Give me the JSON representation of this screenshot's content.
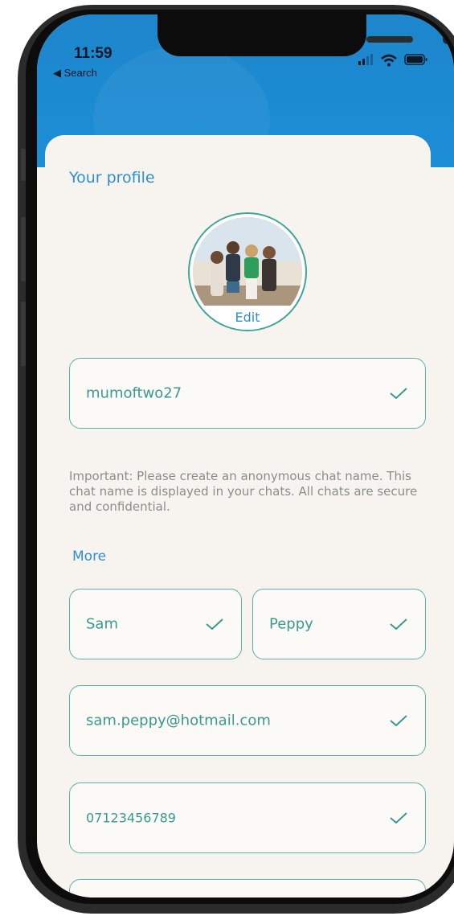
{
  "status_bar": {
    "time": "11:59",
    "back_label": "◀ Search"
  },
  "header": {
    "background": "#1d86cc"
  },
  "profile": {
    "title": "Your profile",
    "avatar_edit_label": "Edit",
    "chat_name": {
      "value": "mumoftwo27",
      "valid": true
    },
    "note": "Important: Please create an anonymous chat name. This chat name is displayed in your chats. All chats are secure and confidential.",
    "more_label": "More",
    "first_name": {
      "value": "Sam",
      "valid": true
    },
    "last_name": {
      "value": "Peppy",
      "valid": true
    },
    "email": {
      "value": "sam.peppy@hotmail.com",
      "valid": true
    },
    "phone": {
      "value": "07123456789",
      "valid": true
    }
  },
  "colors": {
    "accent_blue": "#2f8fcf",
    "field_teal": "#3a9a8f",
    "field_border": "#5eb0a6",
    "background": "#f7f4ef"
  },
  "icons": {
    "check": "check-icon",
    "signal": "signal-icon",
    "wifi": "wifi-icon",
    "battery": "battery-icon"
  }
}
